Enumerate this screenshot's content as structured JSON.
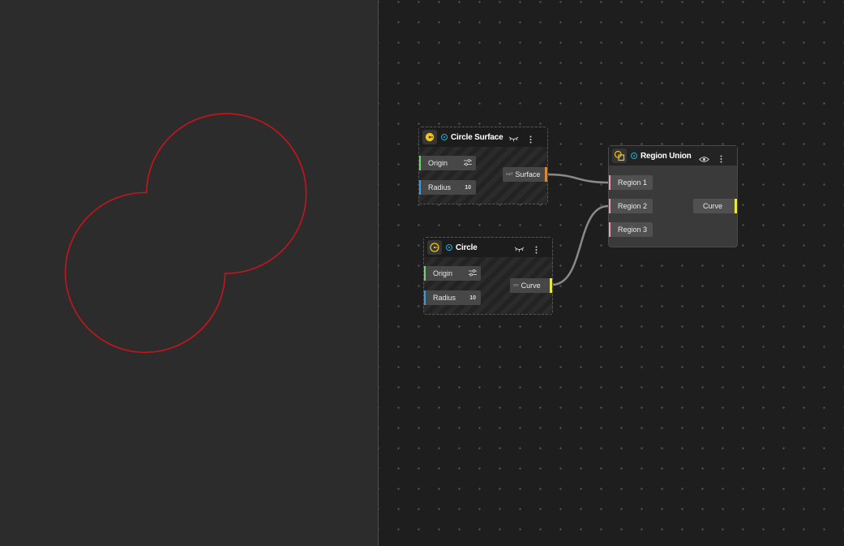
{
  "viewport": {
    "shape_color": "#c8141c"
  },
  "nodes": {
    "circle_surface": {
      "title": "Circle Surface",
      "inputs": [
        {
          "label": "Origin",
          "value": "",
          "port_color": "#6fd66f"
        },
        {
          "label": "Radius",
          "value": "10",
          "port_color": "#3a9be0"
        }
      ],
      "output": {
        "label": "Surface",
        "port_color": "#d9873a",
        "prefix": "surf"
      }
    },
    "circle": {
      "title": "Circle",
      "inputs": [
        {
          "label": "Origin",
          "value": "",
          "port_color": "#6fd66f"
        },
        {
          "label": "Radius",
          "value": "10",
          "port_color": "#3a9be0"
        }
      ],
      "output": {
        "label": "Curve",
        "port_color": "#e8e83a",
        "prefix": "crv"
      }
    },
    "region_union": {
      "title": "Region Union",
      "inputs": [
        {
          "label": "Region 1",
          "port_color": "#e8a0b4"
        },
        {
          "label": "Region 2",
          "port_color": "#e8a0b4"
        },
        {
          "label": "Region 3",
          "port_color": "#e8a0b4"
        }
      ],
      "output": {
        "label": "Curve",
        "port_color": "#e8e83a"
      }
    }
  },
  "colors": {
    "accent": "#f0c419",
    "status": "#1ab3d6",
    "wire": "#8a8a8a"
  },
  "icons": {
    "circle_surface": "circle-surface-icon",
    "circle": "circle-icon",
    "region_union": "region-union-icon",
    "hidden": "eye-closed-icon",
    "visible": "eye-icon",
    "menu": "kebab-menu-icon",
    "tune": "sliders-icon"
  }
}
